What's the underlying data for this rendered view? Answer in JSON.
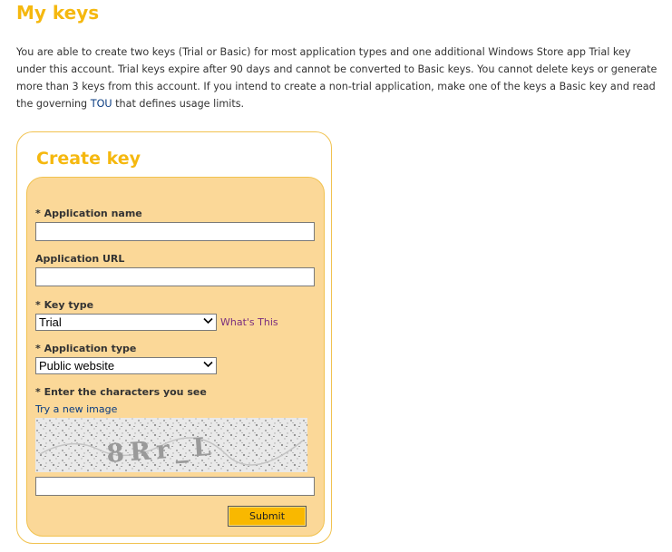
{
  "page": {
    "title": "My keys",
    "intro_before_link": "You are able to create two keys (Trial or Basic) for most application types and one additional Windows Store app Trial key under this account. Trial keys expire after 90 days and cannot be converted to Basic keys. You cannot delete keys or generate more than 3 keys from this account. If you intend to create a non-trial application, make one of the keys a Basic key and read the governing",
    "intro_link": "TOU",
    "intro_after_link": "that defines usage limits."
  },
  "form": {
    "title": "Create key",
    "app_name_label": "* Application name",
    "app_name_value": "",
    "app_url_label": "Application URL",
    "app_url_value": "",
    "key_type_label": "* Key type",
    "key_type_value": "Trial",
    "whats_this_link": "What's This",
    "app_type_label": "* Application type",
    "app_type_value": "Public website",
    "captcha_label": "* Enter the characters you see",
    "new_image_link": "Try a new image",
    "captcha_text": "8Rr_L",
    "captcha_value": "",
    "submit_label": "Submit"
  },
  "colors": {
    "heading": "#f5b80f",
    "panel_fill": "#fbd898",
    "panel_border": "#f1c24f",
    "link": "#0a3c82",
    "visited_link": "#7a2e7e",
    "submit_fill": "#f9b800"
  },
  "icons": {
    "dropdown_arrow": "chevron-down-icon"
  }
}
